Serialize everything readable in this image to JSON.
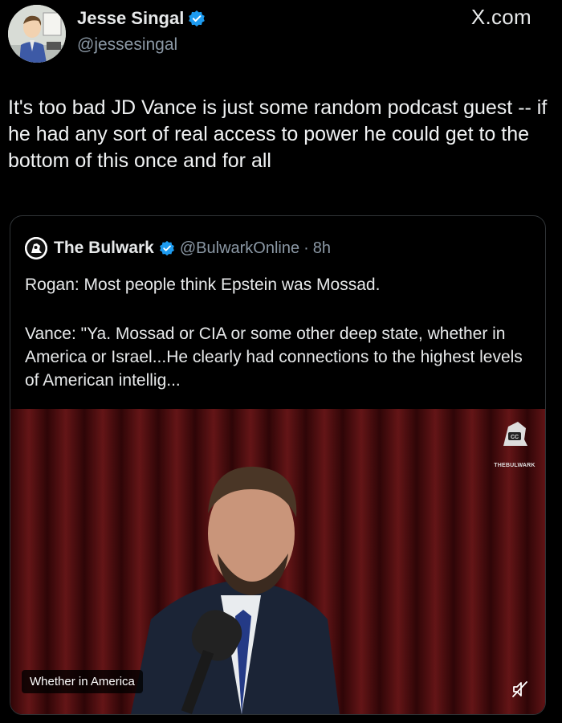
{
  "author": {
    "name": "Jesse Singal",
    "handle": "@jessesingal",
    "verified": true,
    "avatar": "cartoon-portrait-avatar"
  },
  "site_label": "X.com",
  "tweet_text": "It's too bad JD Vance is just some random podcast guest -- if he had any sort of real access to power he could get to the bottom of this once and for all",
  "quoted": {
    "name": "The Bulwark",
    "handle": "@BulwarkOnline",
    "separator": "·",
    "time": "8h",
    "verified": true,
    "line1": "Rogan: Most people think Epstein was Mossad.",
    "line2": "Vance: \"Ya. Mossad or CIA or some other deep state, whether in America or Israel...He clearly had connections to the highest levels of American intellig...",
    "video": {
      "caption": "Whether in America",
      "watermark": "THEBULWARK",
      "watermark_badge": "CC",
      "muted": true
    }
  },
  "colors": {
    "background": "#000000",
    "text": "#e7e9ea",
    "secondary": "#8b98a5",
    "verified": "#1d9bf0",
    "curtain": "#5a0f12"
  }
}
